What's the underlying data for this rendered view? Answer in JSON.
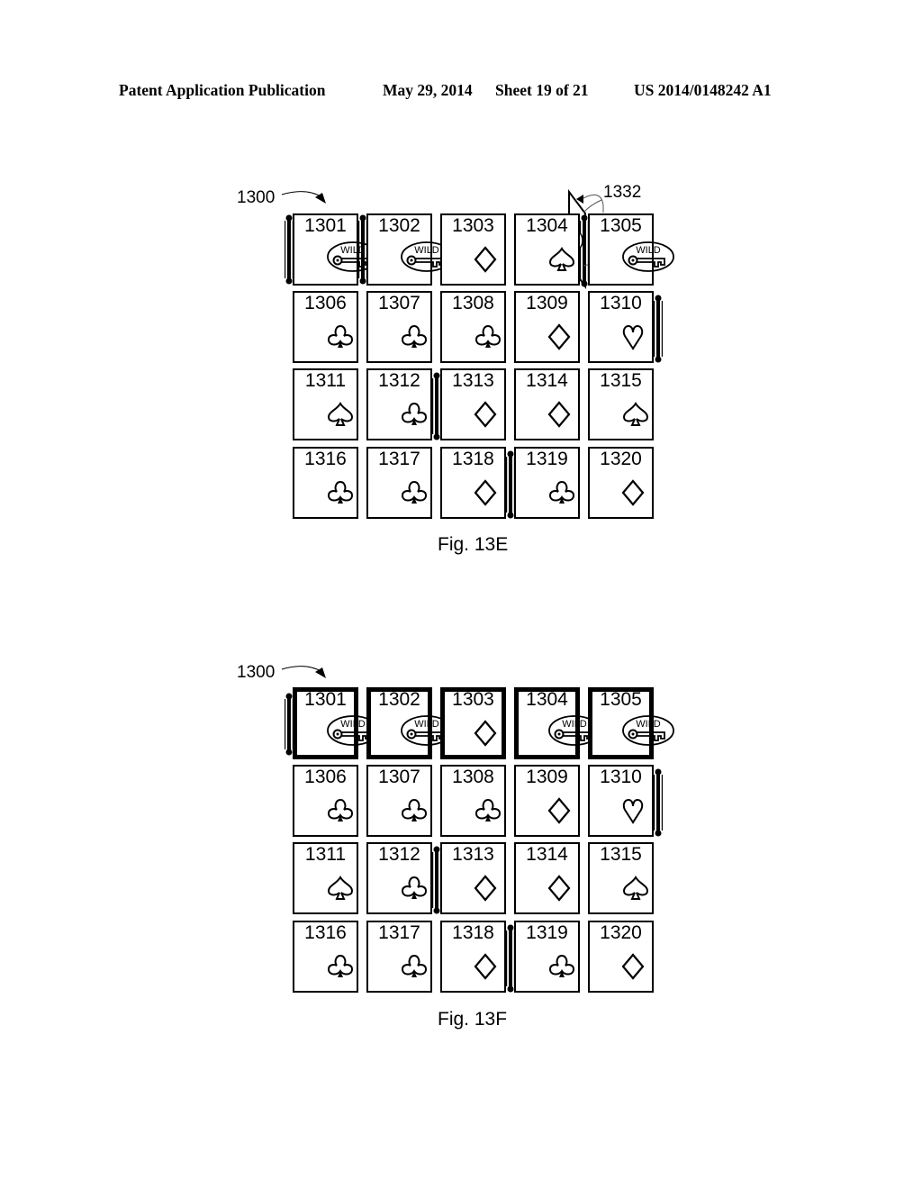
{
  "header": {
    "publication": "Patent Application Publication",
    "date": "May 29, 2014",
    "sheet": "Sheet 19 of 21",
    "number": "US 2014/0148242 A1"
  },
  "figures": [
    {
      "id": "fig13e",
      "caption": "Fig. 13E",
      "reference_label": "1300",
      "callout_label": "1332",
      "cards": [
        {
          "num": "1301",
          "symbol": "wild-key"
        },
        {
          "num": "1302",
          "symbol": "wild-key"
        },
        {
          "num": "1303",
          "symbol": "diamond"
        },
        {
          "num": "1304",
          "symbol": "spade"
        },
        {
          "num": "1305",
          "symbol": "wild-key"
        },
        {
          "num": "1306",
          "symbol": "club"
        },
        {
          "num": "1307",
          "symbol": "club"
        },
        {
          "num": "1308",
          "symbol": "club"
        },
        {
          "num": "1309",
          "symbol": "diamond"
        },
        {
          "num": "1310",
          "symbol": "heart"
        },
        {
          "num": "1311",
          "symbol": "spade"
        },
        {
          "num": "1312",
          "symbol": "club"
        },
        {
          "num": "1313",
          "symbol": "diamond"
        },
        {
          "num": "1314",
          "symbol": "diamond"
        },
        {
          "num": "1315",
          "symbol": "spade"
        },
        {
          "num": "1316",
          "symbol": "club"
        },
        {
          "num": "1317",
          "symbol": "club"
        },
        {
          "num": "1318",
          "symbol": "diamond"
        },
        {
          "num": "1319",
          "symbol": "club"
        },
        {
          "num": "1320",
          "symbol": "diamond"
        }
      ],
      "highlighted_row": null
    },
    {
      "id": "fig13f",
      "caption": "Fig. 13F",
      "reference_label": "1300",
      "cards": [
        {
          "num": "1301",
          "symbol": "wild-key"
        },
        {
          "num": "1302",
          "symbol": "wild-key"
        },
        {
          "num": "1303",
          "symbol": "diamond"
        },
        {
          "num": "1304",
          "symbol": "wild-key"
        },
        {
          "num": "1305",
          "symbol": "wild-key"
        },
        {
          "num": "1306",
          "symbol": "club"
        },
        {
          "num": "1307",
          "symbol": "club"
        },
        {
          "num": "1308",
          "symbol": "club"
        },
        {
          "num": "1309",
          "symbol": "diamond"
        },
        {
          "num": "1310",
          "symbol": "heart"
        },
        {
          "num": "1311",
          "symbol": "spade"
        },
        {
          "num": "1312",
          "symbol": "club"
        },
        {
          "num": "1313",
          "symbol": "diamond"
        },
        {
          "num": "1314",
          "symbol": "diamond"
        },
        {
          "num": "1315",
          "symbol": "spade"
        },
        {
          "num": "1316",
          "symbol": "club"
        },
        {
          "num": "1317",
          "symbol": "club"
        },
        {
          "num": "1318",
          "symbol": "diamond"
        },
        {
          "num": "1319",
          "symbol": "club"
        },
        {
          "num": "1320",
          "symbol": "diamond"
        }
      ],
      "highlighted_row": 0
    }
  ],
  "wild_text": "WILD"
}
